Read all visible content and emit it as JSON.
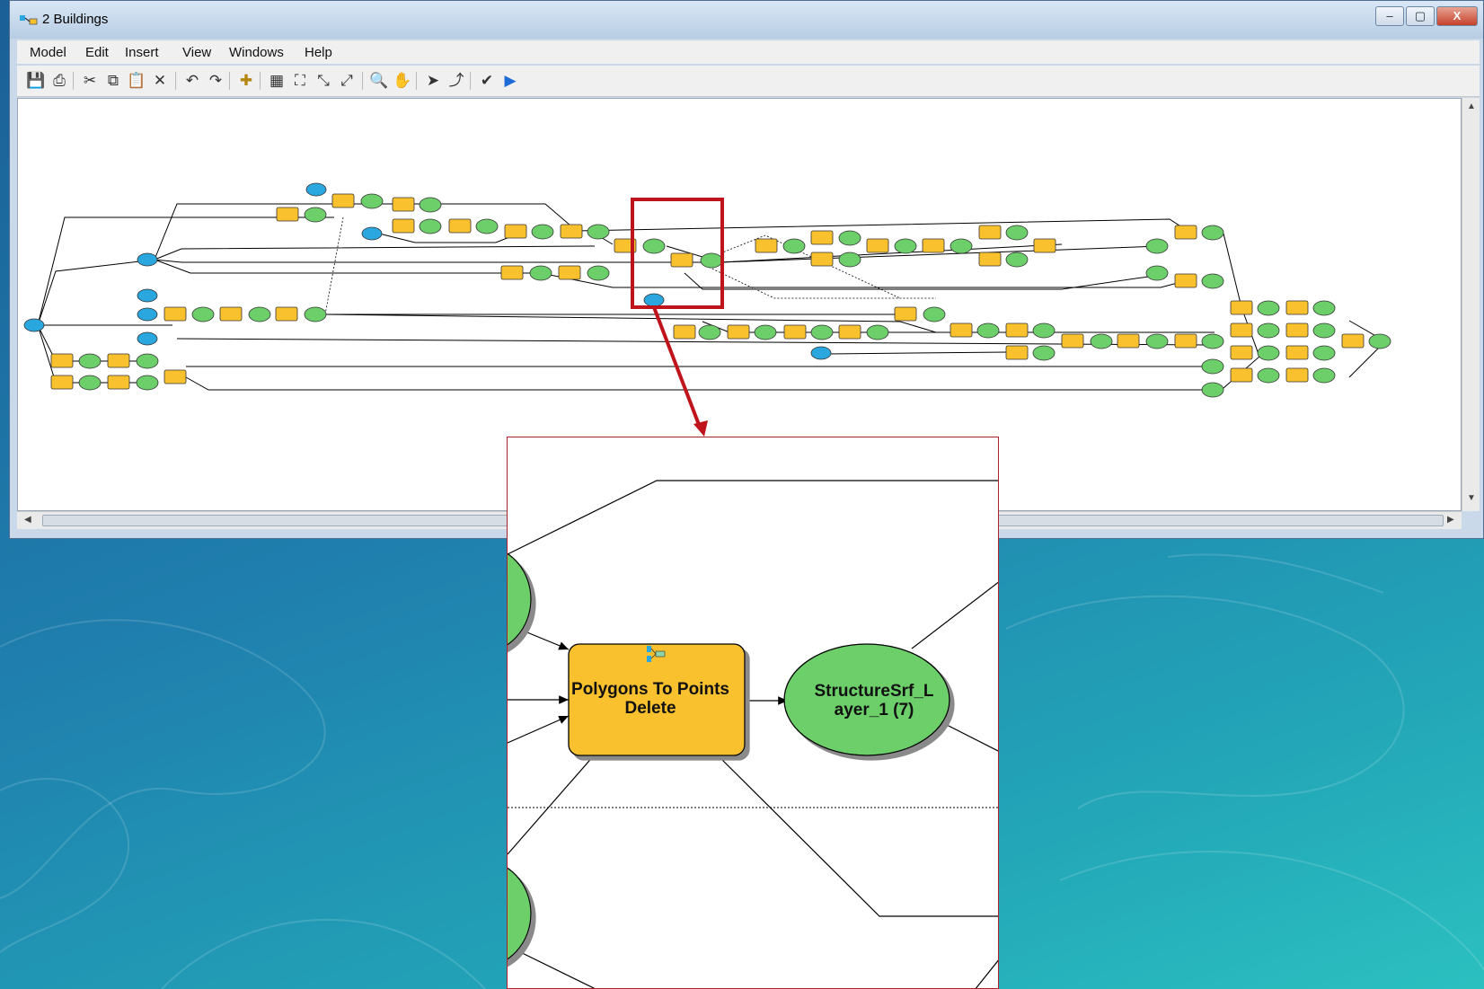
{
  "window": {
    "title": "2 Buildings",
    "controls": {
      "minimize": "–",
      "maximize": "▢",
      "close": "X"
    }
  },
  "menu": [
    "Model",
    "Edit",
    "Insert",
    "View",
    "Windows",
    "Help"
  ],
  "toolbar": [
    {
      "name": "save-icon",
      "glyph": "💾"
    },
    {
      "name": "print-icon",
      "glyph": "⎙"
    },
    {
      "name": "cut-icon",
      "glyph": "✂"
    },
    {
      "name": "copy-icon",
      "glyph": "⧉"
    },
    {
      "name": "paste-icon",
      "glyph": "📋"
    },
    {
      "name": "delete-icon",
      "glyph": "✕"
    },
    {
      "name": "undo-icon",
      "glyph": "↶"
    },
    {
      "name": "redo-icon",
      "glyph": "↷"
    },
    {
      "name": "add-data-icon",
      "glyph": "✚"
    },
    {
      "name": "auto-layout-icon",
      "glyph": "▦"
    },
    {
      "name": "full-extent-icon",
      "glyph": "⛶"
    },
    {
      "name": "fixed-zoom-in-icon",
      "glyph": "⤡"
    },
    {
      "name": "fixed-zoom-out-icon",
      "glyph": "⤢"
    },
    {
      "name": "zoom-in-icon",
      "glyph": "🔍"
    },
    {
      "name": "pan-icon",
      "glyph": "✋"
    },
    {
      "name": "select-icon",
      "glyph": "➤"
    },
    {
      "name": "connect-icon",
      "glyph": "⤴"
    },
    {
      "name": "validate-icon",
      "glyph": "✔"
    },
    {
      "name": "run-icon",
      "glyph": "▶"
    }
  ],
  "zoom": {
    "tool_label": "Polygons To Points Delete",
    "data_label": "StructureSrf_L ayer_1 (7)"
  },
  "colors": {
    "tool_fill": "#f9c12e",
    "data_fill": "#6ccf6a",
    "input_fill": "#2aa7df",
    "highlight": "#c0141c"
  }
}
